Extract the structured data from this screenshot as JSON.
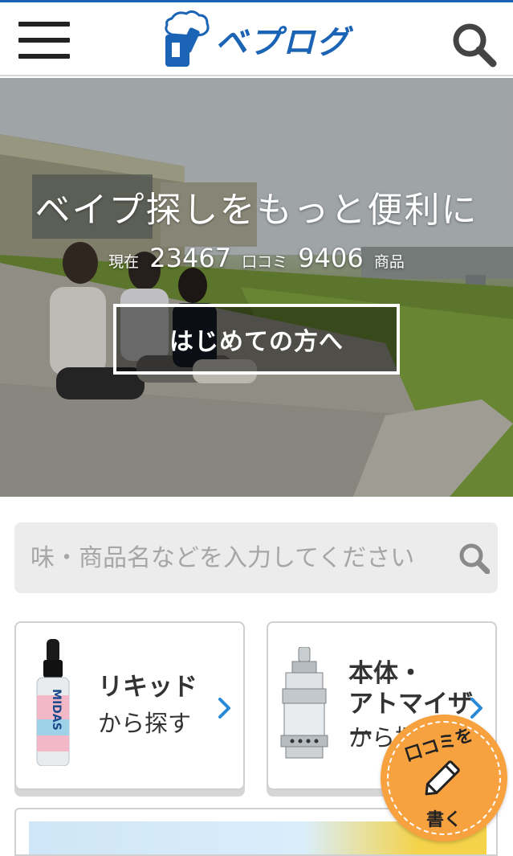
{
  "header": {
    "logo_text": "ベプログ",
    "menu_label": "menu",
    "search_label": "search"
  },
  "hero": {
    "title": "ベイプ探しをもっと便利に",
    "stats": {
      "prefix": "現在",
      "reviews_count": "23467",
      "reviews_label": "口コミ",
      "products_count": "9406",
      "products_label": "商品"
    },
    "cta_label": "はじめての方へ"
  },
  "search": {
    "placeholder": "味・商品名などを入力してください"
  },
  "categories": [
    {
      "title": "リキッド",
      "sub": "から探す",
      "image_label": "MIDAS",
      "icon": "liquid-bottle-icon"
    },
    {
      "title_line1": "本体・",
      "title_line2": "アトマイザー",
      "sub": "から探す",
      "icon": "atomizer-icon"
    }
  ],
  "review_button": {
    "top_text": "口コミを",
    "bottom_text": "書く",
    "icon": "pencil-icon"
  },
  "colors": {
    "brand_blue": "#1b63b5",
    "accent_orange": "#f7a13f",
    "chevron_blue": "#2a8ad8"
  }
}
